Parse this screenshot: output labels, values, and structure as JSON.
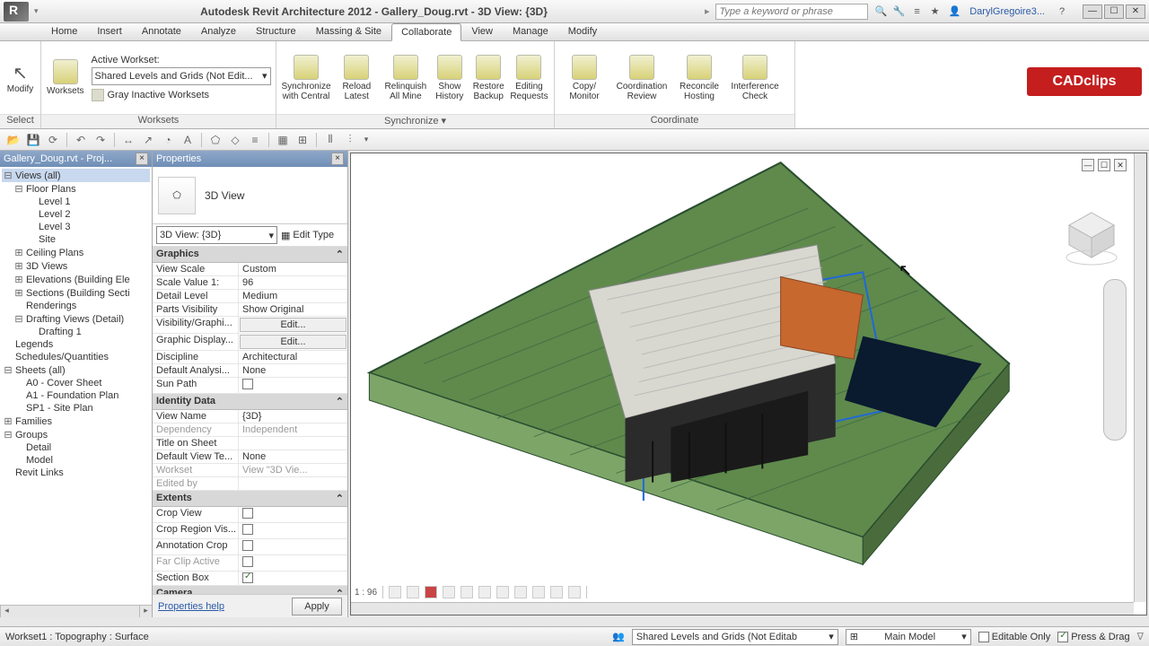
{
  "title": "Autodesk Revit Architecture 2012 -     Gallery_Doug.rvt - 3D View: {3D}",
  "search_placeholder": "Type a keyword or phrase",
  "user": "DarylGregoire3...",
  "tabs": [
    "Home",
    "Insert",
    "Annotate",
    "Analyze",
    "Structure",
    "Massing & Site",
    "Collaborate",
    "View",
    "Manage",
    "Modify"
  ],
  "active_tab": "Collaborate",
  "ribbon": {
    "select_panel": {
      "modify": "Modify",
      "select": "Select"
    },
    "worksets_panel": {
      "button": "Worksets",
      "label": "Active Workset:",
      "combo": "Shared Levels and Grids (Not Edit...",
      "gray": "Gray Inactive Worksets",
      "title": "Worksets"
    },
    "sync_panel": {
      "sync": "Synchronize\nwith Central",
      "reload": "Reload\nLatest",
      "relinq": "Relinquish\nAll Mine",
      "history": "Show\nHistory",
      "restore": "Restore\nBackup",
      "editing": "Editing\nRequests",
      "title": "Synchronize"
    },
    "coord_panel": {
      "copy": "Copy/\nMonitor",
      "review": "Coordination\nReview",
      "reconcile": "Reconcile\nHosting",
      "interf": "Interference\nCheck",
      "title": "Coordinate"
    }
  },
  "logo": "CADclips",
  "browser": {
    "title": "Gallery_Doug.rvt - Proj...",
    "items": [
      {
        "t": "Views (all)",
        "d": 0,
        "sel": true,
        "tw": "-"
      },
      {
        "t": "Floor Plans",
        "d": 1,
        "tw": "-"
      },
      {
        "t": "Level 1",
        "d": 2
      },
      {
        "t": "Level 2",
        "d": 2
      },
      {
        "t": "Level 3",
        "d": 2
      },
      {
        "t": "Site",
        "d": 2
      },
      {
        "t": "Ceiling Plans",
        "d": 1,
        "tw": "+"
      },
      {
        "t": "3D Views",
        "d": 1,
        "tw": "+"
      },
      {
        "t": "Elevations (Building Ele",
        "d": 1,
        "tw": "+"
      },
      {
        "t": "Sections (Building Secti",
        "d": 1,
        "tw": "+"
      },
      {
        "t": "Renderings",
        "d": 1
      },
      {
        "t": "Drafting Views (Detail)",
        "d": 1,
        "tw": "-"
      },
      {
        "t": "Drafting 1",
        "d": 2
      },
      {
        "t": "Legends",
        "d": 0
      },
      {
        "t": "Schedules/Quantities",
        "d": 0
      },
      {
        "t": "Sheets (all)",
        "d": 0,
        "tw": "-"
      },
      {
        "t": "A0 - Cover Sheet",
        "d": 1
      },
      {
        "t": "A1 - Foundation Plan",
        "d": 1
      },
      {
        "t": "SP1 - Site Plan",
        "d": 1
      },
      {
        "t": "Families",
        "d": 0,
        "tw": "+"
      },
      {
        "t": "Groups",
        "d": 0,
        "tw": "-"
      },
      {
        "t": "Detail",
        "d": 1
      },
      {
        "t": "Model",
        "d": 1
      },
      {
        "t": "Revit Links",
        "d": 0
      }
    ]
  },
  "props": {
    "title": "Properties",
    "type_label": "3D View",
    "type_combo": "3D View: {3D}",
    "edit_type": "Edit Type",
    "groups": [
      {
        "h": "Graphics",
        "rows": [
          {
            "k": "View Scale",
            "v": "Custom"
          },
          {
            "k": "Scale Value   1:",
            "v": "96"
          },
          {
            "k": "Detail Level",
            "v": "Medium"
          },
          {
            "k": "Parts Visibility",
            "v": "Show Original"
          },
          {
            "k": "Visibility/Graphi...",
            "v": "Edit...",
            "btn": true
          },
          {
            "k": "Graphic Display...",
            "v": "Edit...",
            "btn": true
          },
          {
            "k": "Discipline",
            "v": "Architectural"
          },
          {
            "k": "Default Analysi...",
            "v": "None"
          },
          {
            "k": "Sun Path",
            "v": "",
            "chk": false
          }
        ]
      },
      {
        "h": "Identity Data",
        "rows": [
          {
            "k": "View Name",
            "v": "{3D}"
          },
          {
            "k": "Dependency",
            "v": "Independent",
            "gray": true
          },
          {
            "k": "Title on Sheet",
            "v": ""
          },
          {
            "k": "Default View Te...",
            "v": "None"
          },
          {
            "k": "Workset",
            "v": "View \"3D Vie...",
            "gray": true
          },
          {
            "k": "Edited by",
            "v": "",
            "gray": true
          }
        ]
      },
      {
        "h": "Extents",
        "rows": [
          {
            "k": "Crop View",
            "v": "",
            "chk": false
          },
          {
            "k": "Crop Region Vis...",
            "v": "",
            "chk": false
          },
          {
            "k": "Annotation Crop",
            "v": "",
            "chk": false
          },
          {
            "k": "Far Clip Active",
            "v": "",
            "chk": false,
            "gray": true
          },
          {
            "k": "Section Box",
            "v": "",
            "chk": true
          }
        ]
      },
      {
        "h": "Camera",
        "rows": []
      }
    ],
    "help": "Properties help",
    "apply": "Apply"
  },
  "view_scale": "1 : 96",
  "status": {
    "left": "Workset1 : Topography : Surface",
    "ws_combo": "Shared Levels and Grids (Not Editab",
    "main_model": "Main Model",
    "editable": "Editable Only",
    "press": "Press & Drag"
  }
}
